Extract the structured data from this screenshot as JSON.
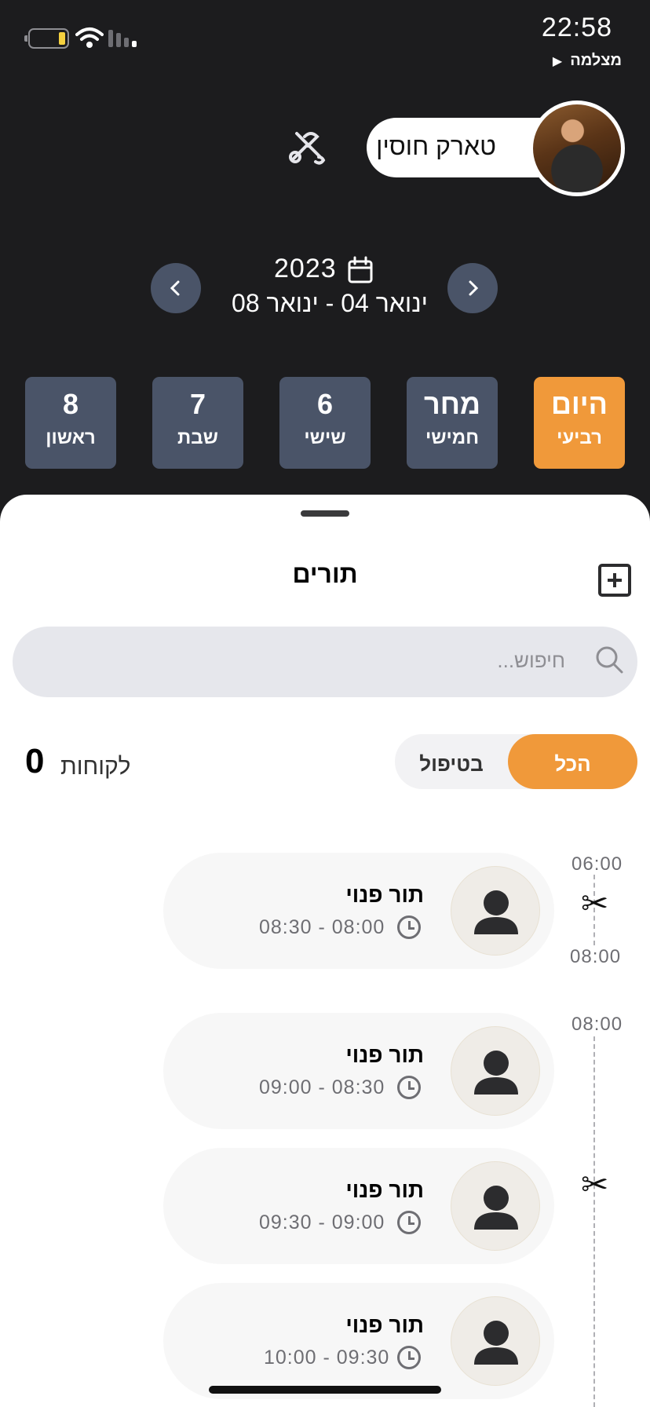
{
  "status_bar": {
    "time": "22:58",
    "back_app": "מצלמה",
    "back_arrow": "▶",
    "icons": [
      "battery-icon",
      "wifi-icon",
      "signal-icon"
    ]
  },
  "header": {
    "user_name": "טארק חוסין",
    "year": "2023",
    "date_range": "ינואר 04 - ינואר 08"
  },
  "days": [
    {
      "top": "היום",
      "bottom": "רביעי",
      "active": true
    },
    {
      "top": "מחר",
      "bottom": "חמישי",
      "active": false
    },
    {
      "top": "6",
      "bottom": "שישי",
      "active": false
    },
    {
      "top": "7",
      "bottom": "שבת",
      "active": false
    },
    {
      "top": "8",
      "bottom": "ראשון",
      "active": false
    }
  ],
  "sheet": {
    "title": "תורים",
    "search_placeholder": "חיפוש...",
    "filter_all": "הכל",
    "filter_in_treatment": "בטיפול",
    "clients_label": "לקוחות",
    "clients_count": "0"
  },
  "timeline": {
    "labels": [
      "06:00",
      "08:00",
      "08:00"
    ],
    "scissors": "✂"
  },
  "appointments": [
    {
      "title": "תור פנוי",
      "time": "08:30 - 08:00"
    },
    {
      "title": "תור פנוי",
      "time": "09:00 - 08:30"
    },
    {
      "title": "תור פנוי",
      "time": "09:30 - 09:00"
    },
    {
      "title": "תור פנוי",
      "time": "10:00 - 09:30"
    }
  ],
  "colors": {
    "accent": "#f0993a",
    "dark_bg": "#1c1c1e",
    "day_tile": "#4a5468"
  }
}
